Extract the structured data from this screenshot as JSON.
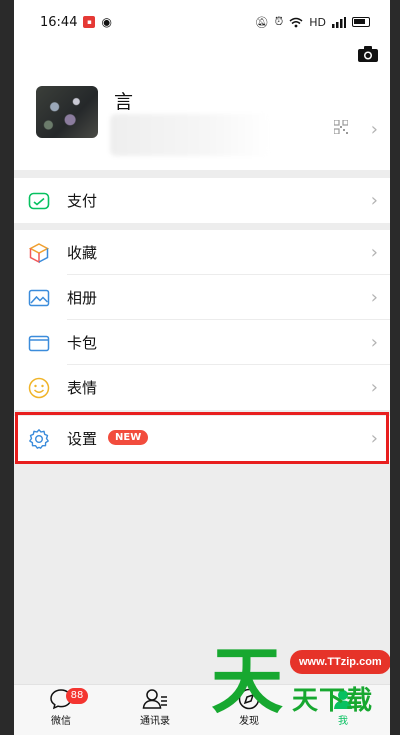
{
  "status_bar": {
    "time": "16:44",
    "network": "HD",
    "icons": [
      "notification-red-icon",
      "weibo-icon",
      "mute-icon",
      "alarm-icon",
      "wifi-icon",
      "signal-icon",
      "battery-icon"
    ]
  },
  "profile": {
    "nickname": "言",
    "icons": [
      "camera-icon",
      "qr-code-icon",
      "chevron-right-icon"
    ]
  },
  "menu": {
    "pay": "支付",
    "favorites": "收藏",
    "album": "相册",
    "cards": "卡包",
    "stickers": "表情",
    "settings": "设置",
    "settings_badge": "NEW",
    "chevron": "›"
  },
  "tabbar": {
    "tabs": [
      {
        "label": "微信",
        "badge": "88",
        "icon": "chat-bubble-icon"
      },
      {
        "label": "通讯录",
        "icon": "contacts-icon"
      },
      {
        "label": "发现",
        "icon": "compass-icon"
      },
      {
        "label": "我",
        "icon": "person-icon",
        "active": true
      }
    ]
  },
  "watermark": {
    "url": "www.TTzip.com",
    "text": "天下载",
    "logo_char": "天"
  },
  "colors": {
    "wechat_green": "#07c160",
    "badge_red": "#f43530",
    "highlight_red": "#e81e1e",
    "watermark_green": "#17a830"
  }
}
